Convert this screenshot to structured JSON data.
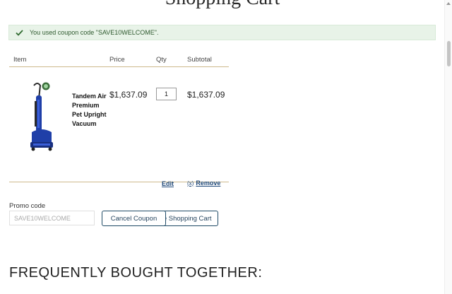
{
  "page": {
    "title": "Shopping Cart"
  },
  "notice": {
    "icon": "checkmark-icon",
    "message": "You used coupon code \"SAVE10WELCOME\"."
  },
  "table": {
    "headers": {
      "item": "Item",
      "price": "Price",
      "qty": "Qty",
      "subtotal": "Subtotal"
    },
    "items": [
      {
        "name": "Tandem Air Premium Pet Upright Vacuum",
        "price": "$1,637.09",
        "qty": "1",
        "subtotal": "$1,637.09",
        "edit_label": "Edit",
        "remove_icon": "close-icon",
        "remove_label": "Remove"
      }
    ]
  },
  "promo": {
    "label": "Promo code",
    "value": "SAVE10WELCOME",
    "cancel_label": "Cancel Coupon",
    "update_label": "Update Shopping Cart"
  },
  "section": {
    "heading": "FREQUENTLY BOUGHT TOGETHER:"
  },
  "colors": {
    "accent": "#1f4a66",
    "notice_bg": "#e8f3e8",
    "divider": "#cdb98c",
    "product": "#1f3fa8"
  }
}
